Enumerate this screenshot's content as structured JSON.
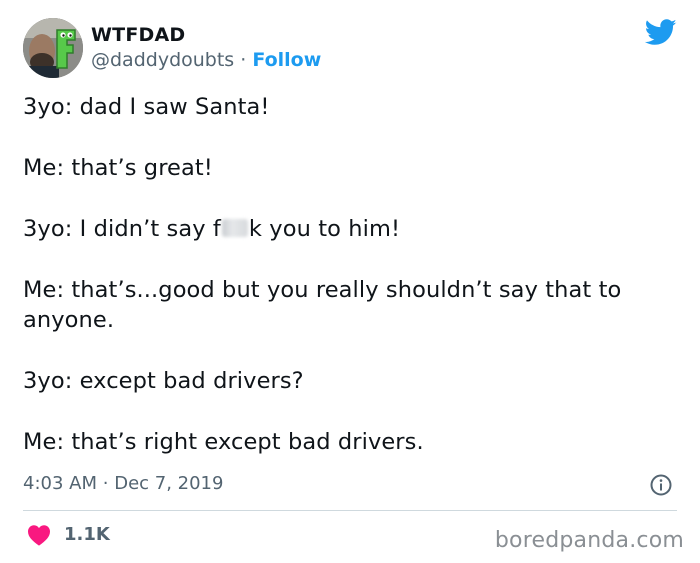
{
  "account": {
    "display_name": "WTFDAD",
    "handle": "@daddydoubts",
    "separator": "·",
    "follow_label": "Follow"
  },
  "icons": {
    "twitter_logo": "twitter-bird-icon",
    "info": "info-circle-icon",
    "like": "heart-icon"
  },
  "tweet": {
    "lines": [
      "3yo: dad I saw Santa!",
      "Me: that’s great!",
      "Me: that’s...good but you really shouldn’t say that to anyone.",
      "3yo: except bad drivers?",
      "Me: that’s right except bad drivers."
    ],
    "censored_line": {
      "prefix": "3yo: I didn’t say f",
      "suffix": "k you to him!"
    }
  },
  "meta": {
    "time": "4:03 AM",
    "separator": "·",
    "date": "Dec 7, 2019"
  },
  "engagement": {
    "likes": "1.1K"
  },
  "watermark": "boredpanda.com",
  "colors": {
    "accent": "#1d9bf0",
    "like": "#f91880",
    "text": "#0f1419",
    "muted": "#536471"
  }
}
